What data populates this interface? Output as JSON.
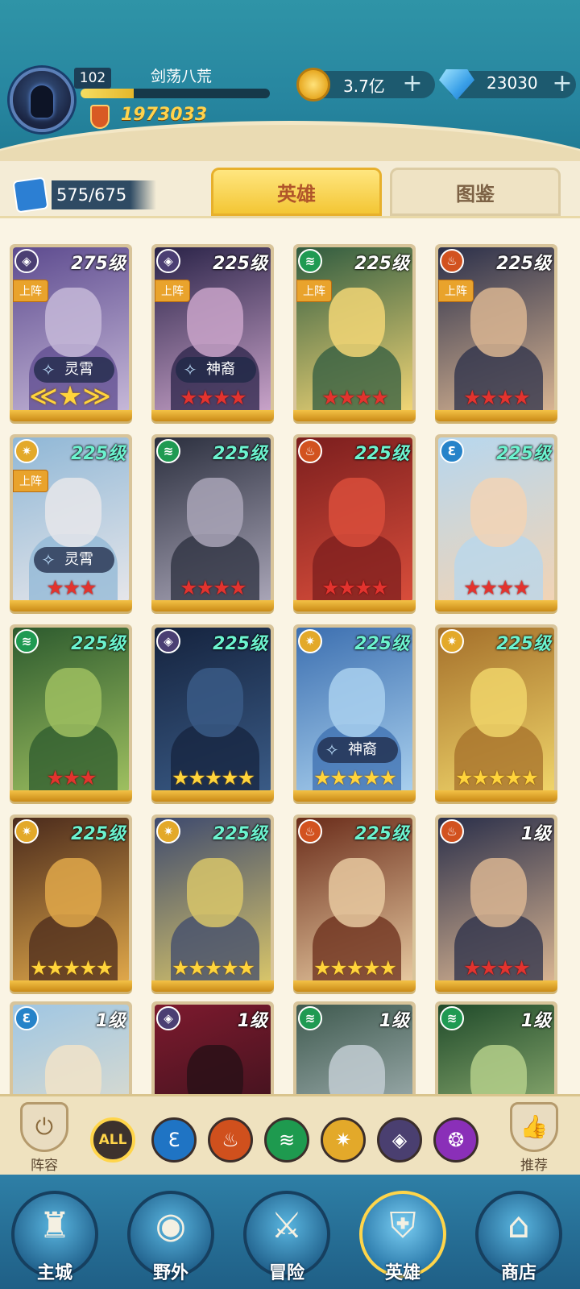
{
  "player": {
    "level": "102",
    "name": "剑荡八荒",
    "power": "1973033",
    "exp_fraction": 0.28
  },
  "resources": {
    "gold": "3.7亿",
    "diamonds": "23030",
    "plus_symbol": "+"
  },
  "collection": {
    "count": "575/675"
  },
  "tabs": {
    "heroes": "英雄",
    "gallery": "图鉴"
  },
  "heroes": [
    {
      "level": "275级",
      "faction": "void",
      "deployed": "上阵",
      "bond": "灵霄",
      "stars": "★",
      "star_color": "gold-wings",
      "art": [
        "#5d4b8f",
        "#c6b8d8"
      ]
    },
    {
      "level": "225级",
      "faction": "void",
      "deployed": "上阵",
      "bond": "神裔",
      "stars": "★★★★",
      "star_color": "red",
      "art": [
        "#2a2348",
        "#c9a3c9"
      ]
    },
    {
      "level": "225级",
      "faction": "wind",
      "deployed": "上阵",
      "bond": "",
      "stars": "★★★★",
      "star_color": "red",
      "art": [
        "#2f5b40",
        "#f2d676"
      ]
    },
    {
      "level": "225级",
      "faction": "fire",
      "deployed": "上阵",
      "bond": "",
      "stars": "★★★★",
      "star_color": "red",
      "art": [
        "#2a2f4a",
        "#d9b592"
      ]
    },
    {
      "level": "225级",
      "faction": "light",
      "deployed": "上阵",
      "bond": "灵霄",
      "stars": "★★★",
      "star_color": "red",
      "art": [
        "#8fb7d6",
        "#e6e6ea"
      ]
    },
    {
      "level": "225级",
      "faction": "wind",
      "deployed": "",
      "bond": "",
      "stars": "★★★★",
      "star_color": "red",
      "art": [
        "#2b2f3e",
        "#a9a5b7"
      ]
    },
    {
      "level": "225级",
      "faction": "fire",
      "deployed": "",
      "bond": "",
      "stars": "★★★★",
      "star_color": "red",
      "art": [
        "#7b1e1e",
        "#d94e3b"
      ]
    },
    {
      "level": "225级",
      "faction": "water",
      "deployed": "",
      "bond": "",
      "stars": "★★★★",
      "star_color": "red",
      "art": [
        "#b6d7ef",
        "#f2d4b5"
      ]
    },
    {
      "level": "225级",
      "faction": "wind",
      "deployed": "",
      "bond": "",
      "stars": "★★★",
      "star_color": "red",
      "art": [
        "#2c5a2e",
        "#9fc060"
      ]
    },
    {
      "level": "225级",
      "faction": "void",
      "deployed": "",
      "bond": "",
      "stars": "★★★★★",
      "star_color": "gold",
      "art": [
        "#15233e",
        "#3a5b86"
      ]
    },
    {
      "level": "225级",
      "faction": "light",
      "deployed": "",
      "bond": "神裔",
      "stars": "★★★★★",
      "star_color": "gold",
      "art": [
        "#3c6fb0",
        "#a9d0ee"
      ]
    },
    {
      "level": "225级",
      "faction": "light",
      "deployed": "",
      "bond": "",
      "stars": "★★★★★",
      "star_color": "gold",
      "art": [
        "#a46f2a",
        "#f0d56a"
      ]
    },
    {
      "level": "225级",
      "faction": "light",
      "deployed": "",
      "bond": "",
      "stars": "★★★★★",
      "star_color": "gold",
      "art": [
        "#4a2a1c",
        "#e0a84a"
      ]
    },
    {
      "level": "225级",
      "faction": "light",
      "deployed": "",
      "bond": "",
      "stars": "★★★★★",
      "star_color": "gold",
      "art": [
        "#3e4a6e",
        "#d8c56a"
      ]
    },
    {
      "level": "225级",
      "faction": "fire",
      "deployed": "",
      "bond": "",
      "stars": "★★★★★",
      "star_color": "gold",
      "art": [
        "#6a2c1a",
        "#e7c9a0"
      ]
    },
    {
      "level": "1级",
      "faction": "fire",
      "deployed": "",
      "bond": "",
      "stars": "★★★★",
      "star_color": "red",
      "art": [
        "#2a2f4a",
        "#d9b592"
      ]
    },
    {
      "level": "1级",
      "faction": "water",
      "deployed": "",
      "bond": "",
      "stars": "",
      "star_color": "red",
      "art": [
        "#9fc6e3",
        "#f1e3c8"
      ]
    },
    {
      "level": "1级",
      "faction": "void",
      "deployed": "",
      "bond": "",
      "stars": "",
      "star_color": "red",
      "art": [
        "#7d1a2e",
        "#2a1018"
      ]
    },
    {
      "level": "1级",
      "faction": "wind",
      "deployed": "",
      "bond": "",
      "stars": "",
      "star_color": "red",
      "art": [
        "#3f5a4f",
        "#c2cdd2"
      ]
    },
    {
      "level": "1级",
      "faction": "wind",
      "deployed": "",
      "bond": "",
      "stars": "",
      "star_color": "red",
      "art": [
        "#1f4a2a",
        "#b4cf8a"
      ]
    }
  ],
  "faction_icons": {
    "void": {
      "color": "#4b3f73",
      "glyph": "◈"
    },
    "wind": {
      "color": "#1f9a52",
      "glyph": "≋"
    },
    "fire": {
      "color": "#d2521f",
      "glyph": "♨"
    },
    "light": {
      "color": "#e3a92a",
      "glyph": "✷"
    },
    "water": {
      "color": "#2683c9",
      "glyph": "Ɛ"
    }
  },
  "filters": {
    "lineup_label": "阵容",
    "recommend_label": "推荐",
    "all_label": "ALL",
    "items": [
      {
        "name": "water",
        "color": "#1f74c4",
        "glyph": "Ɛ"
      },
      {
        "name": "fire",
        "color": "#d0501d",
        "glyph": "♨"
      },
      {
        "name": "wind",
        "color": "#1e9a4f",
        "glyph": "≋"
      },
      {
        "name": "light",
        "color": "#e3a92a",
        "glyph": "✷"
      },
      {
        "name": "void",
        "color": "#4a3f70",
        "glyph": "◈"
      },
      {
        "name": "arcane",
        "color": "#8a2fb8",
        "glyph": "❂"
      }
    ]
  },
  "nav": [
    {
      "label": "主城",
      "glyph": "♜"
    },
    {
      "label": "野外",
      "glyph": "◉"
    },
    {
      "label": "冒险",
      "glyph": "⚔"
    },
    {
      "label": "英雄",
      "glyph": "⛨",
      "active": true
    },
    {
      "label": "商店",
      "glyph": "⌂"
    }
  ]
}
